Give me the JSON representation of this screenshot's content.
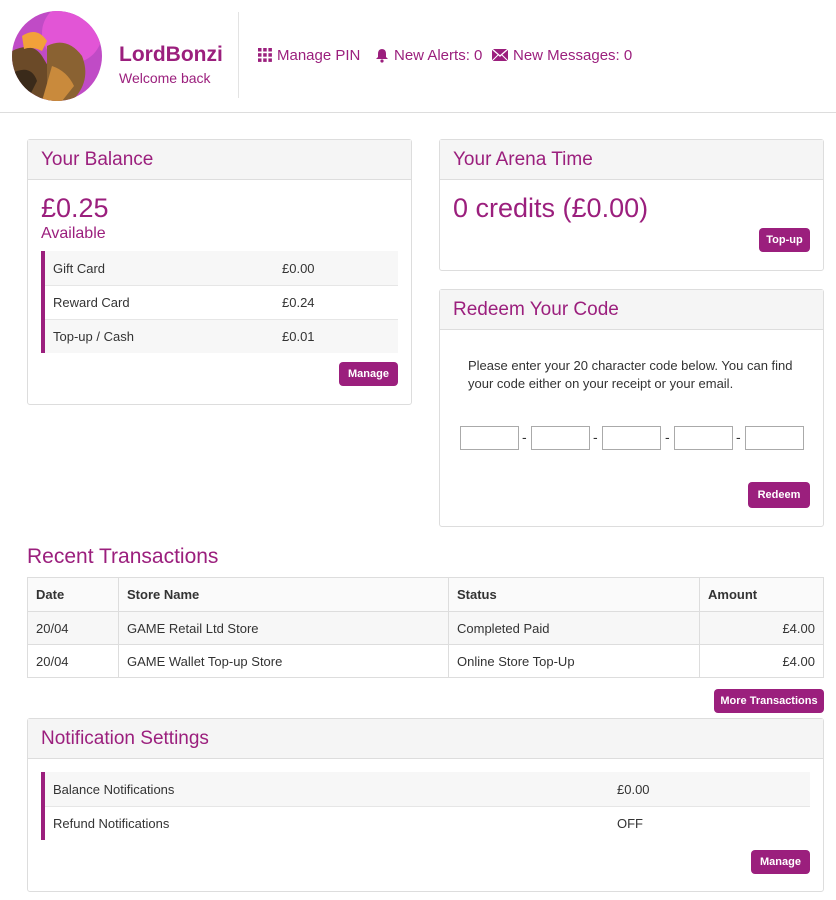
{
  "user": {
    "name": "LordBonzi",
    "greeting": "Welcome back"
  },
  "topnav": {
    "manage_pin": "Manage PIN",
    "alerts_label": "New Alerts: 0",
    "messages_label": "New Messages: 0"
  },
  "balance": {
    "title": "Your Balance",
    "amount": "£0.25",
    "available_label": "Available",
    "rows": [
      {
        "label": "Gift Card",
        "value": "£0.00"
      },
      {
        "label": "Reward Card",
        "value": "£0.24"
      },
      {
        "label": "Top-up / Cash",
        "value": "£0.01"
      }
    ],
    "manage_label": "Manage"
  },
  "arena": {
    "title": "Your Arena Time",
    "amount": "0 credits (£0.00)",
    "topup_label": "Top-up"
  },
  "redeem": {
    "title": "Redeem Your Code",
    "instructions": "Please enter your 20 character code below. You can find your code either on your receipt or your email.",
    "separator": "-",
    "redeem_label": "Redeem"
  },
  "transactions": {
    "title": "Recent Transactions",
    "columns": [
      "Date",
      "Store Name",
      "Status",
      "Amount"
    ],
    "rows": [
      {
        "date": "20/04",
        "store": "GAME Retail Ltd Store",
        "status": "Completed Paid",
        "amount": "£4.00"
      },
      {
        "date": "20/04",
        "store": "GAME Wallet Top-up Store",
        "status": "Online Store Top-Up",
        "amount": "£4.00"
      }
    ],
    "more_label": "More Transactions"
  },
  "notifications": {
    "title": "Notification Settings",
    "rows": [
      {
        "label": "Balance Notifications",
        "value": "£0.00"
      },
      {
        "label": "Refund Notifications",
        "value": "OFF"
      }
    ],
    "manage_label": "Manage"
  },
  "colors": {
    "accent": "#9b1f7d",
    "panel_header": "#f5f5f5",
    "border": "#dddddd"
  },
  "icons": {
    "manage_pin": "grid-icon",
    "alerts": "bell-icon",
    "messages": "envelope-icon"
  }
}
